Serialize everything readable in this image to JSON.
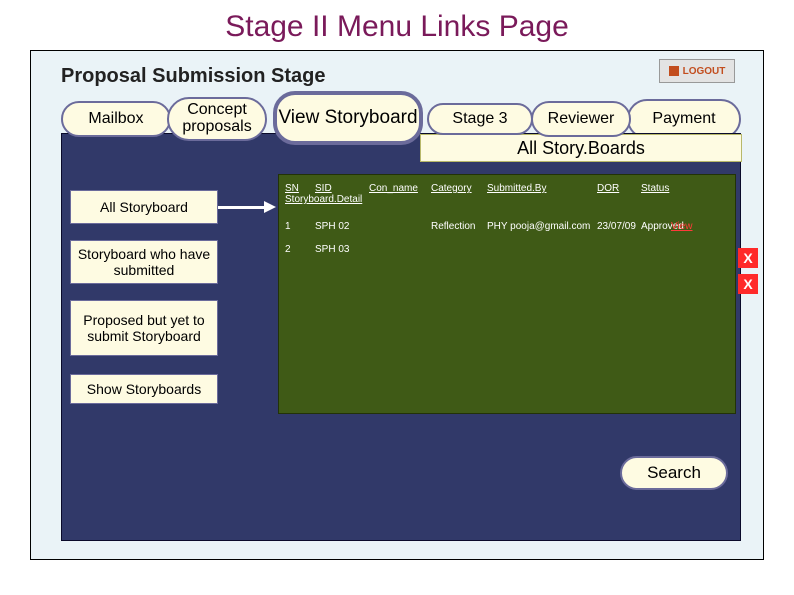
{
  "page_title": "Stage II Menu Links Page",
  "stage_label": "Proposal Submission Stage",
  "logout_label": "LOGOUT",
  "nav": {
    "mailbox": "Mailbox",
    "concept": "Concept proposals",
    "view_storyboard": "View Storyboard",
    "stage3": "Stage 3",
    "reviewer": "Reviewer",
    "payment": "Payment"
  },
  "banner": "All  Story.Boards",
  "sidebar": {
    "all": "All Storyboard",
    "submitted": "Storyboard who have submitted",
    "proposed": "Proposed but yet to submit Storyboard",
    "show": "Show Storyboards"
  },
  "table": {
    "headers": {
      "sn": "SN",
      "sid": "SID",
      "con_name": "Con_name",
      "category": "Category",
      "submitted_by": "Submitted.By",
      "dor": "DOR",
      "status": "Status"
    },
    "subheader": "Storyboard.Detail",
    "rows": [
      {
        "sn": "1",
        "sid": "SPH 02",
        "con": "",
        "cat": "Reflection",
        "sub": "PHY pooja@gmail.com",
        "dor": "23/07/09",
        "status": "Approved",
        "view": "View"
      },
      {
        "sn": "2",
        "sid": "SPH 03",
        "con": "",
        "cat": "",
        "sub": "",
        "dor": "",
        "status": "",
        "view": ""
      }
    ],
    "delete_label": "X"
  },
  "search_label": "Search"
}
